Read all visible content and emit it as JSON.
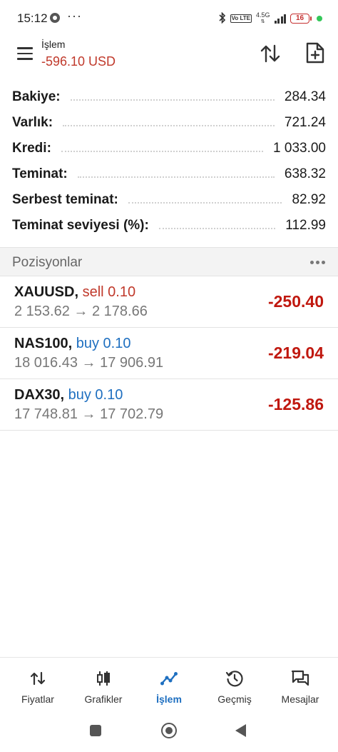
{
  "status_bar": {
    "time": "15:12",
    "dots": "···",
    "network": "4.5G",
    "volte": "Vo LTE",
    "battery": "16"
  },
  "header": {
    "title": "İşlem",
    "balance_change": "-596.10 USD"
  },
  "summary": [
    {
      "label": "Bakiye:",
      "value": "284.34"
    },
    {
      "label": "Varlık:",
      "value": "721.24"
    },
    {
      "label": "Kredi:",
      "value": "1 033.00"
    },
    {
      "label": "Teminat:",
      "value": "638.32"
    },
    {
      "label": "Serbest teminat:",
      "value": "82.92"
    },
    {
      "label": "Teminat seviyesi (%):",
      "value": "112.99"
    }
  ],
  "positions_section": {
    "title": "Pozisyonlar"
  },
  "positions": [
    {
      "symbol": "XAUUSD,",
      "side": "sell 0.10",
      "prices": "2 153.62 → 2 178.66",
      "pl": "-250.40"
    },
    {
      "symbol": "NAS100,",
      "side": "buy 0.10",
      "prices": "18 016.43 → 17 906.91",
      "pl": "-219.04"
    },
    {
      "symbol": "DAX30,",
      "side": "buy 0.10",
      "prices": "17 748.81 → 17 702.79",
      "pl": "-125.86"
    }
  ],
  "bottom_nav": [
    {
      "label": "Fiyatlar",
      "icon": "quotes-icon"
    },
    {
      "label": "Grafikler",
      "icon": "candlestick-icon"
    },
    {
      "label": "İşlem",
      "icon": "trade-icon"
    },
    {
      "label": "Geçmiş",
      "icon": "history-icon"
    },
    {
      "label": "Mesajlar",
      "icon": "messages-icon"
    }
  ],
  "colors": {
    "loss": "#c0180f",
    "sell": "#c0392b",
    "buy": "#1e6fc0",
    "active_tab": "#1e6fc0"
  }
}
